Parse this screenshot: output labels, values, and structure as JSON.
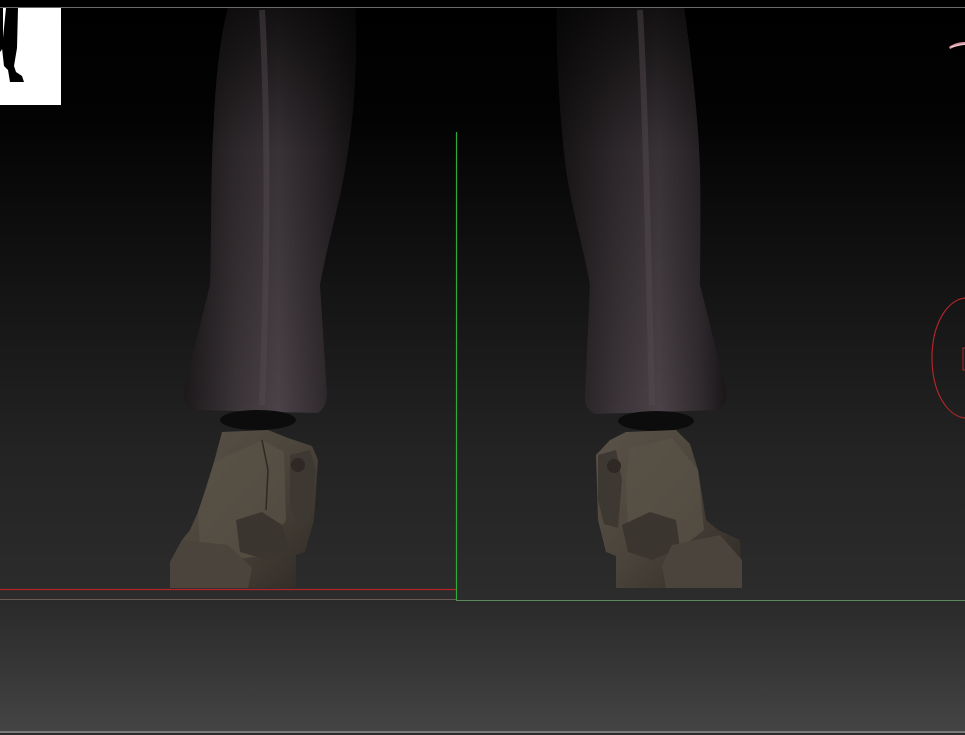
{
  "app": {
    "view": "3d-viewport",
    "subject": "character-legs-and-boots"
  },
  "colors": {
    "background_top": "#000000",
    "background_bottom": "#2c2c2c",
    "floor": "#3a3a3a",
    "axis_x": "#b0262a",
    "axis_y": "#2faa3a",
    "axis_z_floor": "#5a8a5a",
    "rotation_ring": "#b0262a",
    "pants": "#3a3337",
    "boots": "#4e463d",
    "navigator_bg": "#ffffff",
    "navigator_figure": "#000000",
    "border": "#6b6b6b"
  },
  "icons": {
    "navigator": "figure-silhouette-icon",
    "gizmo": "transform-gizmo-icon",
    "rotation": "rotation-ring-icon"
  }
}
